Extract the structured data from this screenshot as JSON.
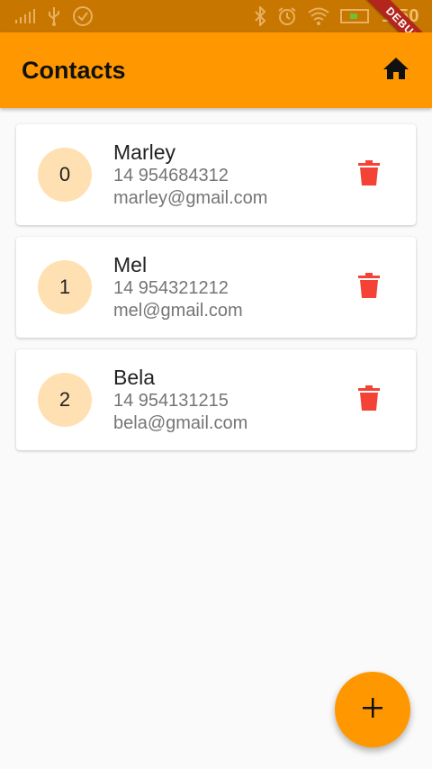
{
  "status_bar": {
    "icons": [
      "signal-icon",
      "usb-icon",
      "check-circle-icon",
      "bluetooth-icon",
      "alarm-icon",
      "wifi-icon",
      "battery-icon"
    ],
    "time": "1:50"
  },
  "debug_banner": "DEBUG",
  "app_bar": {
    "title": "Contacts",
    "action_icon": "home-icon"
  },
  "contacts": [
    {
      "index": "0",
      "name": "Marley",
      "phone": "14 954684312",
      "email": "marley@gmail.com"
    },
    {
      "index": "1",
      "name": "Mel",
      "phone": "14 954321212",
      "email": "mel@gmail.com"
    },
    {
      "index": "2",
      "name": "Bela",
      "phone": "14 954131215",
      "email": "bela@gmail.com"
    }
  ],
  "fab": {
    "icon": "plus-icon"
  },
  "colors": {
    "primary": "#ff9800",
    "status_bar": "#c77700",
    "avatar_bg": "#ffe0b2",
    "delete": "#f44336",
    "background": "#fafafa"
  }
}
